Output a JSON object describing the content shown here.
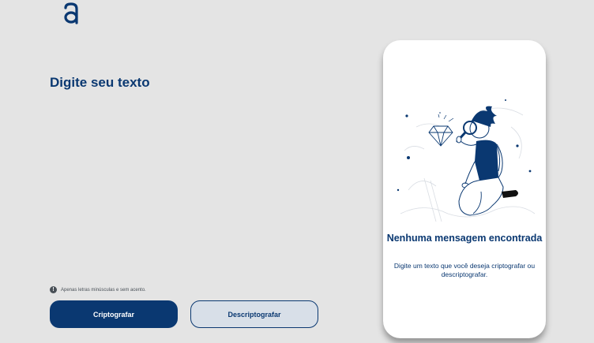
{
  "app": {
    "logo_name": "alura-logo",
    "brand_color": "#0a3871",
    "background_color": "#e4e4e4"
  },
  "editor": {
    "title": "Digite seu texto",
    "value": "",
    "placeholder": ""
  },
  "hint": {
    "icon": "exclamation-circle-icon",
    "text": "Apenas letras minúsculas e sem acento."
  },
  "actions": {
    "encrypt_label": "Criptografar",
    "decrypt_label": "Descriptografar"
  },
  "output_panel": {
    "illustration": "person-with-magnifying-glass-and-diamond",
    "title": "Nenhuma mensagem encontrada",
    "message": "Digite um texto que você deseja criptografar ou descriptografar."
  }
}
